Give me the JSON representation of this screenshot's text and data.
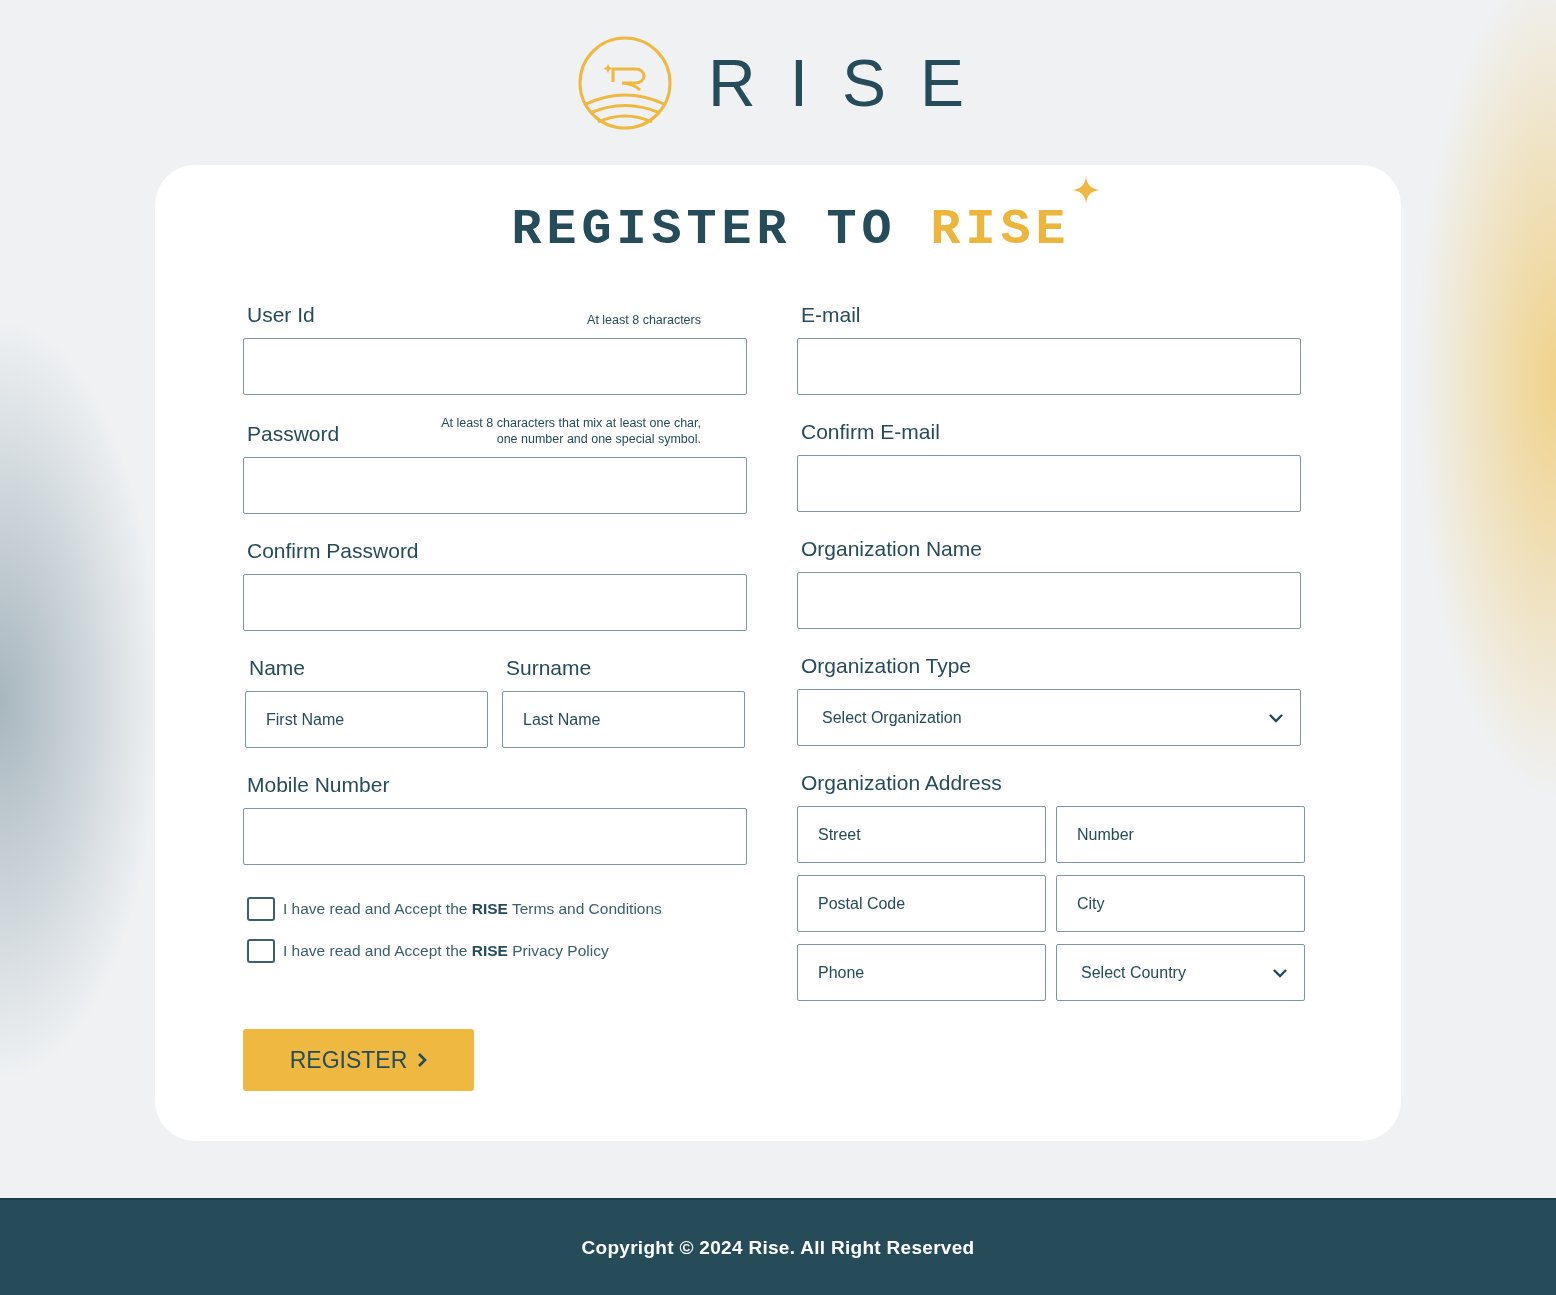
{
  "logo": {
    "wordmark": "RISE"
  },
  "title": {
    "lead": "REGISTER TO",
    "accent": "RISE"
  },
  "account_fields": [
    {
      "label": "User Id",
      "hint": "At least 8 characters"
    },
    {
      "label": "Password",
      "hint": "At least 8 characters that mix at least one char,\none number and one special symbol."
    },
    {
      "label": "Confirm Password"
    }
  ],
  "name_fields": [
    {
      "label": "Name",
      "placeholder": "First Name"
    },
    {
      "label": "Surname",
      "placeholder": "Last Name"
    }
  ],
  "mobile": {
    "label": "Mobile Number"
  },
  "agreements": [
    {
      "text": "I have read and Accept the **RISE** Terms and Conditions",
      "checked": false
    },
    {
      "text": "I have read and Accept the **RISE** Privacy Policy",
      "checked": false
    }
  ],
  "register_button": {
    "label": "REGISTER"
  },
  "contact_fields": [
    {
      "label": "E-mail"
    },
    {
      "label": "Confirm E-mail"
    },
    {
      "label": "Organization Name"
    }
  ],
  "organization_type": {
    "label": "Organization Type",
    "placeholder": "Select Organization"
  },
  "address": {
    "label": "Organization Address",
    "fields": [
      {
        "kind": "input",
        "placeholder": "Street"
      },
      {
        "kind": "input",
        "placeholder": "Number"
      },
      {
        "kind": "input",
        "placeholder": "Postal Code"
      },
      {
        "kind": "input",
        "placeholder": "City"
      },
      {
        "kind": "input",
        "placeholder": "Phone"
      },
      {
        "kind": "select",
        "placeholder": "Select Country"
      }
    ]
  },
  "footer": {
    "text": "Copyright © 2024 Rise. All Right Reserved"
  }
}
